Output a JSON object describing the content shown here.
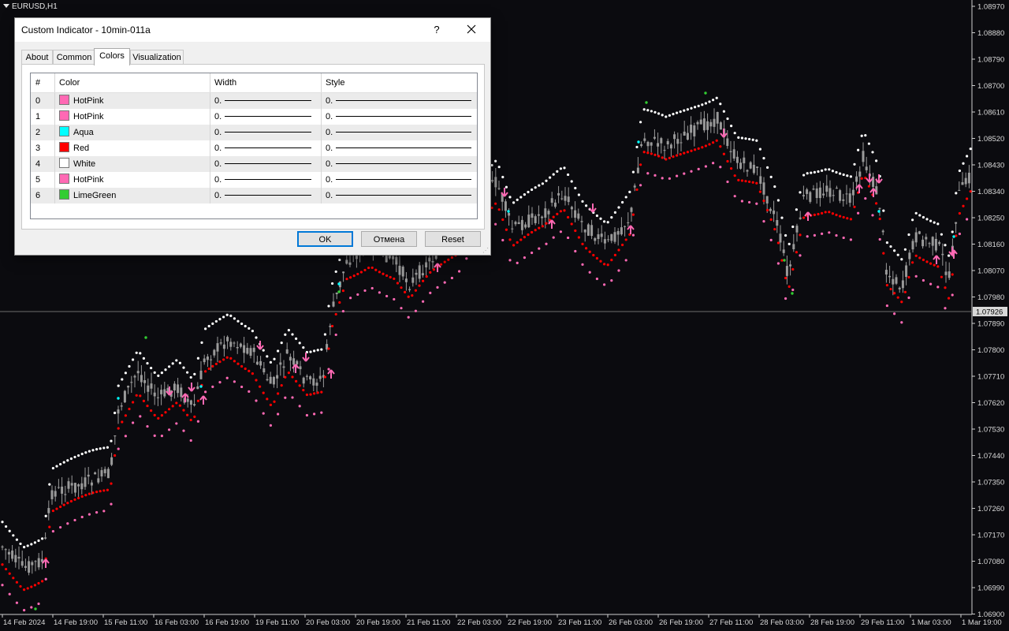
{
  "chart": {
    "symbol": "EURUSD,H1",
    "current_price": "1.07926",
    "price_axis": [
      "1.08970",
      "1.08880",
      "1.08790",
      "1.08700",
      "1.08610",
      "1.08520",
      "1.08430",
      "1.08340",
      "1.08250",
      "1.08160",
      "1.08070",
      "1.07980",
      "1.07890",
      "1.07800",
      "1.07710",
      "1.07620",
      "1.07530",
      "1.07440",
      "1.07350",
      "1.07260",
      "1.07170",
      "1.07080",
      "1.06990",
      "1.06900"
    ],
    "time_axis": [
      "14 Feb 2024",
      "14 Feb 19:00",
      "15 Feb 11:00",
      "16 Feb 03:00",
      "16 Feb 19:00",
      "19 Feb 11:00",
      "20 Feb 03:00",
      "20 Feb 19:00",
      "21 Feb 11:00",
      "22 Feb 03:00",
      "22 Feb 19:00",
      "23 Feb 11:00",
      "26 Feb 03:00",
      "26 Feb 19:00",
      "27 Feb 11:00",
      "28 Feb 03:00",
      "28 Feb 19:00",
      "29 Feb 11:00",
      "1 Mar 03:00",
      "1 Mar 19:00"
    ],
    "colors": {
      "background": "#0b0b0f",
      "candle": "#9a9a9a",
      "hotpink": "#ff69b4",
      "red": "#ff0000",
      "white": "#ffffff",
      "aqua": "#00ffff",
      "limegreen": "#32cd32"
    }
  },
  "dialog": {
    "title": "Custom Indicator - 10min-011a",
    "help": "?",
    "close_icon": "close-icon",
    "tabs": [
      "About",
      "Common",
      "Colors",
      "Visualization"
    ],
    "active_tab": "Colors",
    "table": {
      "headers": [
        "#",
        "Color",
        "Width",
        "Style"
      ],
      "rows": [
        {
          "num": "0",
          "color": "HotPink",
          "hex": "#ff69b4",
          "width": "0.",
          "style": "0."
        },
        {
          "num": "1",
          "color": "HotPink",
          "hex": "#ff69b4",
          "width": "0.",
          "style": "0."
        },
        {
          "num": "2",
          "color": "Aqua",
          "hex": "#00ffff",
          "width": "0.",
          "style": "0."
        },
        {
          "num": "3",
          "color": "Red",
          "hex": "#ff0000",
          "width": "0.",
          "style": "0."
        },
        {
          "num": "4",
          "color": "White",
          "hex": "#ffffff",
          "width": "0.",
          "style": "0."
        },
        {
          "num": "5",
          "color": "HotPink",
          "hex": "#ff69b4",
          "width": "0.",
          "style": "0."
        },
        {
          "num": "6",
          "color": "LimeGreen",
          "hex": "#32cd32",
          "width": "0.",
          "style": "0."
        }
      ]
    },
    "buttons": {
      "ok": "OK",
      "cancel": "Отмена",
      "reset": "Reset"
    }
  }
}
